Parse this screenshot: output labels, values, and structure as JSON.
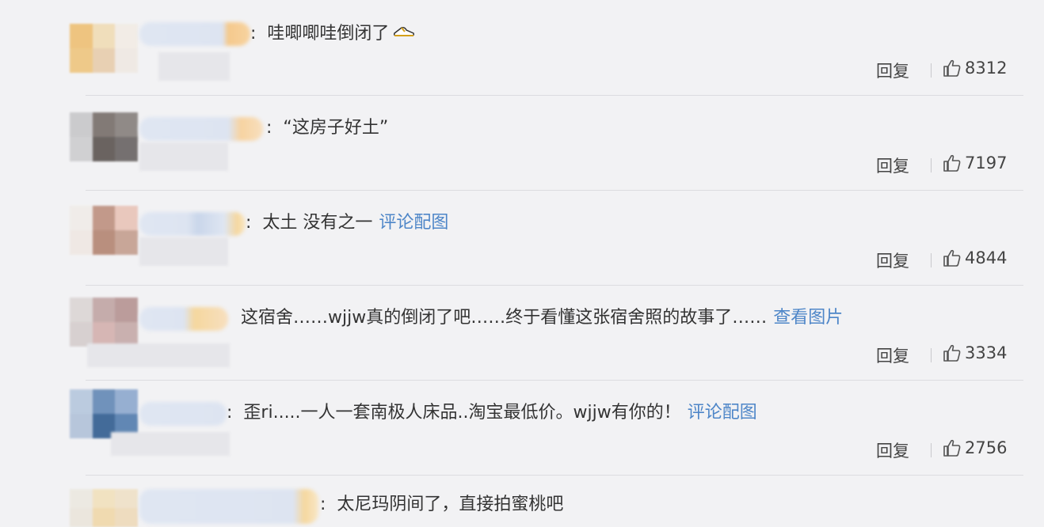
{
  "comments": [
    {
      "text": "哇唧唧哇倒闭了",
      "has_emoji": true,
      "emoji": "slipper-emoji",
      "link": "",
      "reply_label": "回复",
      "likes": "8312"
    },
    {
      "text": "“这房子好土”",
      "has_emoji": false,
      "link": "",
      "reply_label": "回复",
      "likes": "7197"
    },
    {
      "text": "太土 没有之一",
      "has_emoji": false,
      "link": "评论配图",
      "reply_label": "回复",
      "likes": "4844"
    },
    {
      "text": "这宿舍……wjjw真的倒闭了吧……终于看懂这张宿舍照的故事了……",
      "has_emoji": false,
      "link": "查看图片",
      "reply_label": "回复",
      "likes": "3334"
    },
    {
      "text": "歪ri.....一人一套南极人床品..淘宝最低价。wjjw有你的！",
      "has_emoji": false,
      "link": "评论配图",
      "reply_label": "回复",
      "likes": "2756"
    },
    {
      "text": "太尼玛阴间了，直接拍蜜桃吧",
      "has_emoji": false,
      "link": "",
      "reply_label": "",
      "likes": ""
    }
  ],
  "colors": {
    "background": "#f2f2f4",
    "link": "#4e86c8",
    "text": "#333333"
  },
  "icons": {
    "like": "thumbs-up-icon"
  }
}
